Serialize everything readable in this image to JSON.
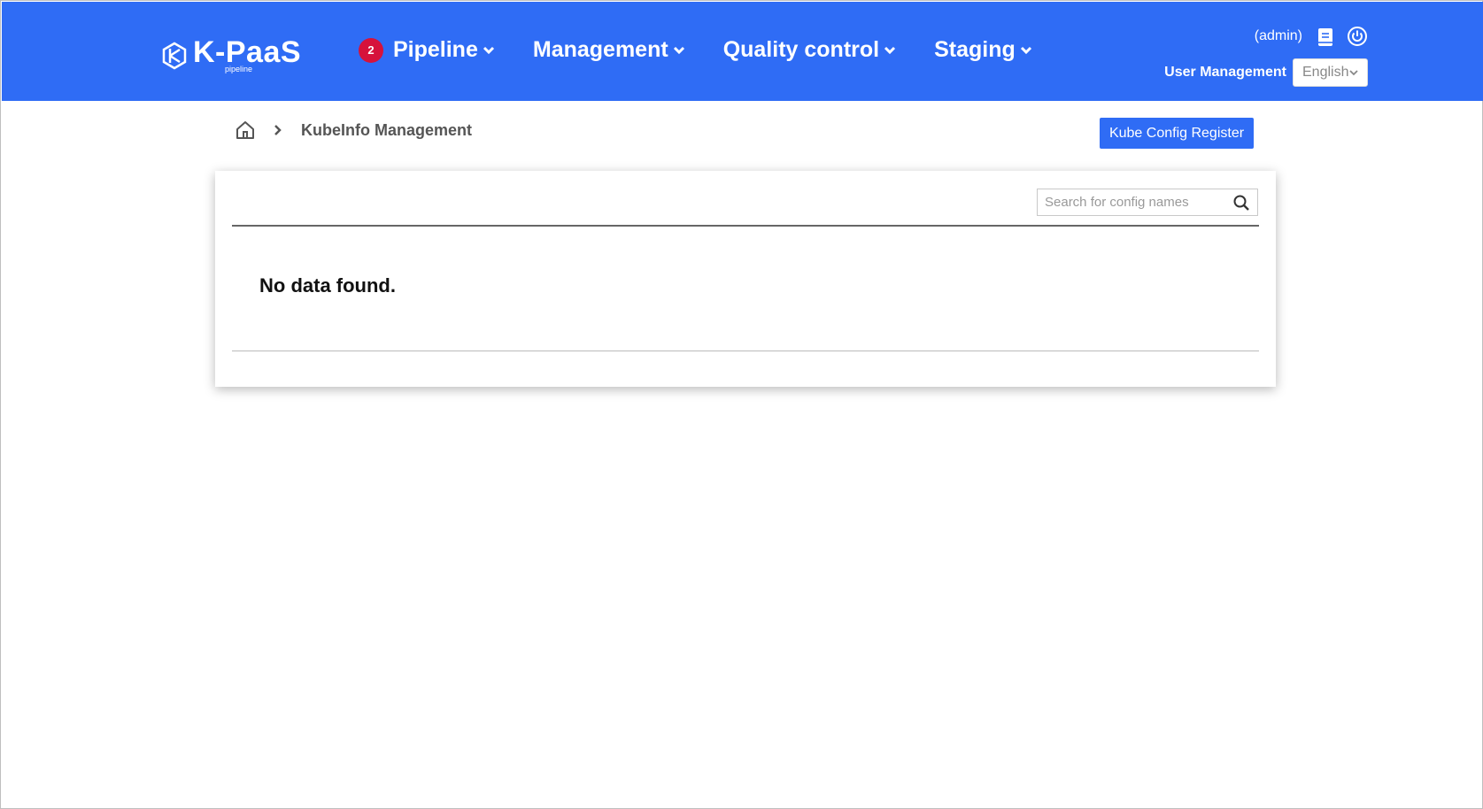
{
  "header": {
    "logo_name": "K-PaaS",
    "logo_sub": "pipeline",
    "nav": [
      {
        "label": "Pipeline",
        "badge": "2"
      },
      {
        "label": "Management"
      },
      {
        "label": "Quality control"
      },
      {
        "label": "Staging"
      }
    ],
    "user": "(admin)",
    "user_management": "User Management",
    "language": "English"
  },
  "breadcrumb": {
    "current": "KubeInfo Management"
  },
  "actions": {
    "register_label": "Kube Config Register"
  },
  "list": {
    "search_placeholder": "Search for config names",
    "empty_message": "No data found."
  },
  "colors": {
    "header_bg": "#2f6cf5",
    "badge": "#d6123b",
    "primary_button": "#2f6cf5"
  }
}
